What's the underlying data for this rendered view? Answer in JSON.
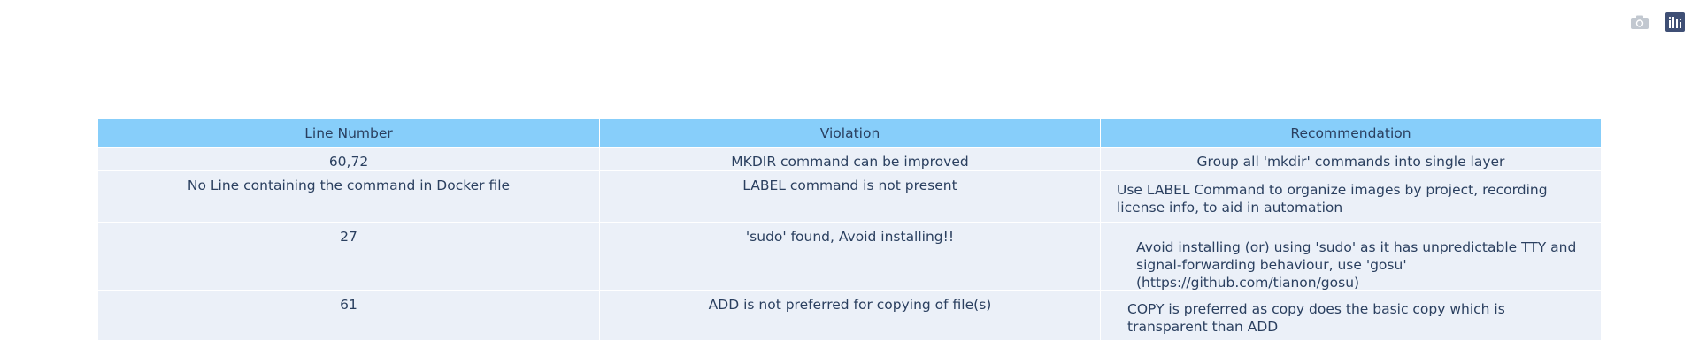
{
  "modebar": {
    "camera_icon": "camera-icon",
    "plotly_logo_icon": "bar-chart-logo-icon"
  },
  "table": {
    "header_color": "#87cefa",
    "cell_color": "#ebf0f8",
    "columns": [
      "Line Number",
      "Violation",
      "Recommendation"
    ],
    "rows": [
      {
        "line": "60,72",
        "violation": "MKDIR command can be improved",
        "recommendation": "Group all 'mkdir' commands into single layer"
      },
      {
        "line": "No Line containing the command in Docker file",
        "violation": "LABEL command is not present",
        "recommendation": "Use LABEL Command to organize images by project, recording license info, to aid in automation"
      },
      {
        "line": "27",
        "violation": "'sudo' found, Avoid installing!!",
        "recommendation": "Avoid installing (or) using 'sudo' as it has unpredictable TTY and signal-forwarding behaviour, use 'gosu' (https://github.com/tianon/gosu)"
      },
      {
        "line": "61",
        "violation": "ADD is not preferred for copying of file(s)",
        "recommendation": "COPY is preferred as copy does the basic copy which is transparent than ADD"
      }
    ]
  }
}
